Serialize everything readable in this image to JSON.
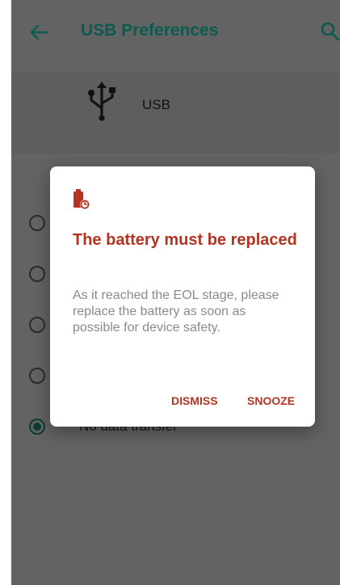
{
  "toolbar": {
    "title": "USB Preferences",
    "back_icon": "arrow-back-icon",
    "search_icon": "search-icon"
  },
  "usb_header": {
    "label": "USB",
    "icon": "usb-icon"
  },
  "options": {
    "selected_index": 4,
    "visible_label": "No data transfer"
  },
  "dialog": {
    "icon": "battery-alert-icon",
    "title": "The battery must be replaced",
    "message": "As it reached the EOL stage, please replace the battery as soon as possible for device safety.",
    "dismiss_label": "DISMISS",
    "snooze_label": "SNOOZE"
  },
  "colors": {
    "accent": "#b43422",
    "toolbar_title": "#0d5b50",
    "scrim_background": "#636363",
    "message_text": "#8a8a8a",
    "radio_selected": "#0c3d32"
  }
}
